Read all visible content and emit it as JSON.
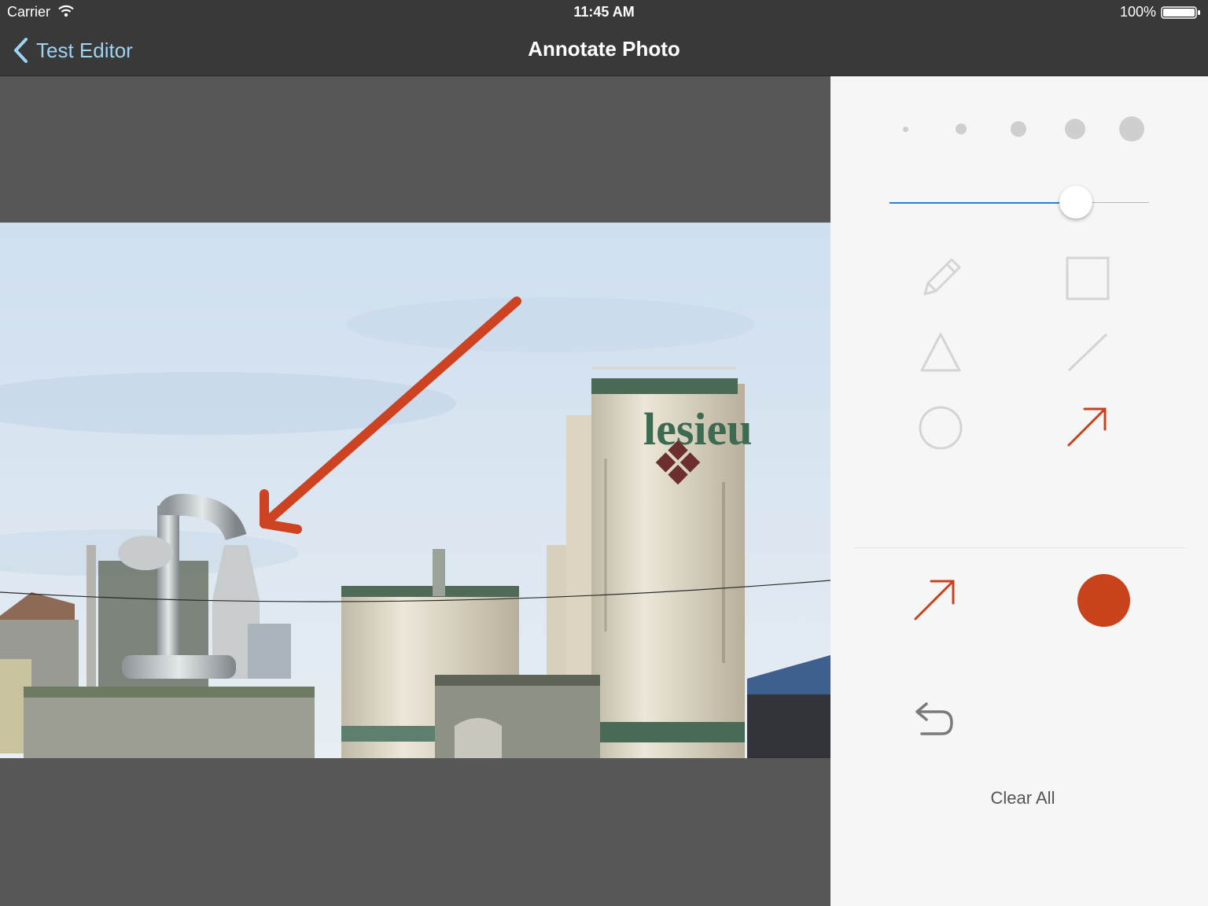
{
  "status_bar": {
    "carrier": "Carrier",
    "time": "11:45 AM",
    "battery": "100%"
  },
  "nav": {
    "back_label": "Test Editor",
    "title": "Annotate Photo"
  },
  "photo": {
    "tank_text": "lesieu"
  },
  "tools": {
    "stroke_sizes": 5,
    "stroke_width_level": 0.71,
    "items": [
      "pencil-icon",
      "square-icon",
      "triangle-icon",
      "line-icon",
      "circle-icon",
      "arrow-icon"
    ],
    "selected": "arrow-icon",
    "current_color": "#c8421c",
    "inactive_color": "#d4d4d4",
    "clear_all_label": "Clear All"
  }
}
